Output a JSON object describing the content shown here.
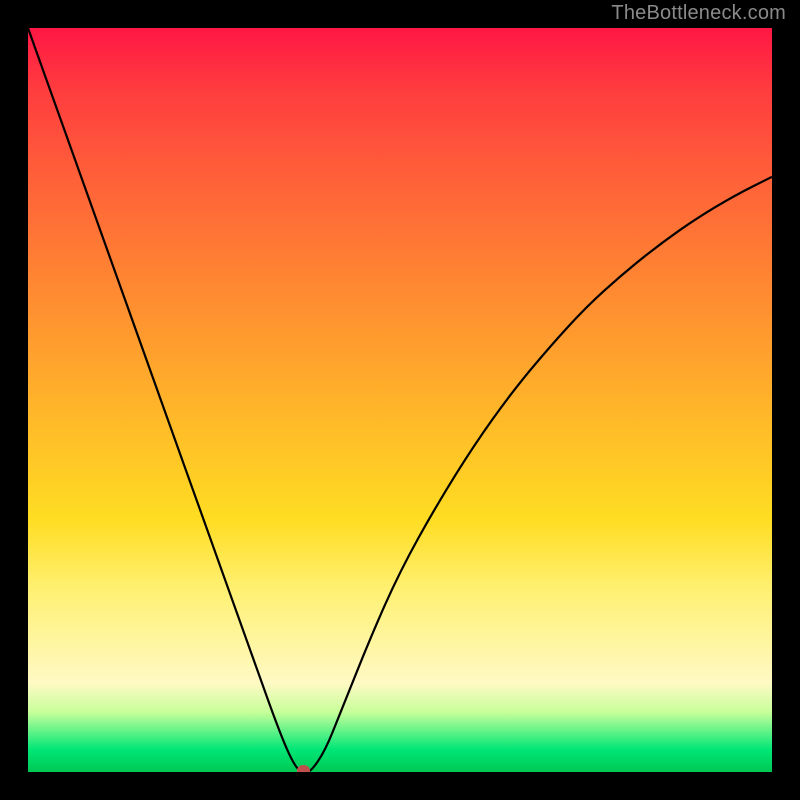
{
  "watermark": "TheBottleneck.com",
  "plot": {
    "inner_left": 28,
    "inner_top": 28,
    "inner_width": 744,
    "inner_height": 744,
    "border_thickness": 28
  },
  "chart_data": {
    "type": "line",
    "title": "",
    "xlabel": "",
    "ylabel": "",
    "xlim": [
      0,
      100
    ],
    "ylim": [
      0,
      100
    ],
    "series": [
      {
        "name": "curve",
        "x": [
          0,
          5,
          10,
          15,
          20,
          25,
          30,
          34,
          36,
          37,
          38,
          40,
          42,
          46,
          50,
          55,
          60,
          65,
          70,
          75,
          80,
          85,
          90,
          95,
          100
        ],
        "values": [
          100,
          86,
          72,
          58,
          44,
          30,
          16,
          4.8,
          0.5,
          0,
          0,
          3,
          8,
          18,
          27,
          36,
          44,
          51,
          57,
          62.5,
          67,
          71,
          74.5,
          77.5,
          80
        ]
      }
    ],
    "marker": {
      "x": 37,
      "y": 0,
      "radius_pct": 0.9,
      "color": "#c0504d"
    }
  }
}
